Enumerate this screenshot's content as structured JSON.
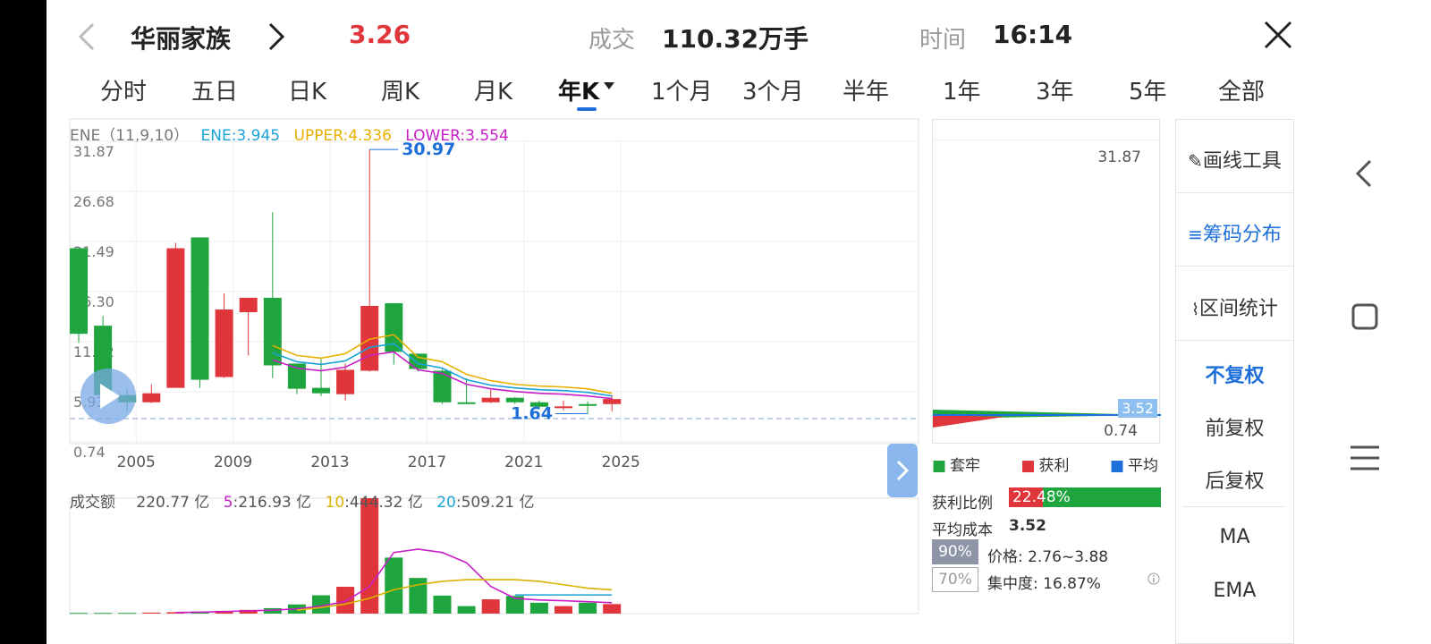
{
  "header": {
    "back_icon": "chevron-left-icon",
    "stock_name": "华丽家族",
    "next_icon": "chevron-right-icon",
    "price": "3.26",
    "volume_label": "成交",
    "volume_value": "110.32万手",
    "time_label": "时间",
    "time_value": "16:14",
    "close_icon": "close-icon"
  },
  "tabs": [
    "分时",
    "五日",
    "日K",
    "周K",
    "月K",
    "年K",
    "1个月",
    "3个月",
    "半年",
    "1年",
    "3年",
    "5年",
    "全部"
  ],
  "active_tab": "年K",
  "indicator": {
    "name": "ENE（11,9,10）",
    "ene": "ENE:3.945",
    "upper": "UPPER:4.336",
    "lower": "LOWER:3.554"
  },
  "price_axis": [
    "31.87",
    "26.68",
    "21.49",
    "16.30",
    "11.12",
    "5.93",
    "0.74"
  ],
  "x_axis": [
    "2005",
    "2009",
    "2013",
    "2017",
    "2021",
    "2025"
  ],
  "annotations": {
    "high": "30.97",
    "low": "1.64"
  },
  "volume_legend": {
    "label": "成交额",
    "total": "220.77 亿",
    "ma5_key": "5",
    "ma5_val": ":216.93 亿",
    "ma10_key": "10",
    "ma10_val": ":444.32 亿",
    "ma20_key": "20",
    "ma20_val": ":509.21 亿"
  },
  "chip_panel": {
    "top_value": "31.87",
    "current_value": "3.52",
    "bottom_value": "0.74",
    "legend": [
      "套牢",
      "获利",
      "平均"
    ],
    "profit_ratio_label": "获利比例",
    "profit_ratio_value": "22.48%",
    "profit_ratio": 0.2248,
    "avg_cost_label": "平均成本",
    "avg_cost_value": "3.52",
    "badge_90": "90%",
    "range_90": "价格: 2.76~3.88",
    "badge_70": "70%",
    "concentration": "集中度: 16.87%",
    "info_icon": "info-icon"
  },
  "side_menu": {
    "draw_tool": "画线工具",
    "chip_dist": "筹码分布",
    "range_stats": "区间统计",
    "no_adjust": "不复权",
    "forward_adjust": "前复权",
    "backward_adjust": "后复权",
    "ma": "MA",
    "ema": "EMA"
  },
  "nav": {
    "back": "nav-back-icon",
    "home": "nav-home-icon",
    "menu": "nav-menu-icon"
  },
  "colors": {
    "up": "#e0363b",
    "down": "#1fa53d",
    "ene": "#1aa3d8",
    "upper": "#e8b000",
    "lower": "#c71ec7",
    "accent": "#1e6fd9",
    "ma5": "#c71ec7",
    "ma10": "#d8b400",
    "ma20": "#1aa3d8"
  },
  "chart_data": {
    "type": "candlestick",
    "years": [
      2003,
      2004,
      2005,
      2006,
      2007,
      2008,
      2009,
      2010,
      2011,
      2012,
      2013,
      2014,
      2015,
      2016,
      2017,
      2018,
      2019,
      2020,
      2021,
      2022,
      2023,
      2024,
      2025
    ],
    "candles": [
      {
        "o": 20.0,
        "c": 10.5,
        "h": 20.0,
        "l": 9.5
      },
      {
        "o": 11.4,
        "c": 3.7,
        "h": 12.5,
        "l": 3.2
      },
      {
        "o": 3.7,
        "c": 2.9,
        "h": 4.3,
        "l": 1.9
      },
      {
        "o": 2.9,
        "c": 3.9,
        "h": 4.9,
        "l": 2.8
      },
      {
        "o": 4.5,
        "c": 20.0,
        "h": 20.6,
        "l": 4.5
      },
      {
        "o": 21.2,
        "c": 5.4,
        "h": 21.2,
        "l": 4.5
      },
      {
        "o": 5.7,
        "c": 13.2,
        "h": 15.0,
        "l": 5.6
      },
      {
        "o": 12.9,
        "c": 14.5,
        "h": 14.5,
        "l": 8.1
      },
      {
        "o": 14.5,
        "c": 7.0,
        "h": 24.0,
        "l": 5.6
      },
      {
        "o": 7.2,
        "c": 4.4,
        "h": 7.2,
        "l": 3.8
      },
      {
        "o": 4.5,
        "c": 3.9,
        "h": 7.7,
        "l": 3.6
      },
      {
        "o": 3.8,
        "c": 6.5,
        "h": 7.2,
        "l": 3.1
      },
      {
        "o": 6.4,
        "c": 13.6,
        "h": 30.97,
        "l": 6.3
      },
      {
        "o": 13.9,
        "c": 8.5,
        "h": 13.9,
        "l": 7.1
      },
      {
        "o": 8.3,
        "c": 6.6,
        "h": 8.3,
        "l": 6.3
      },
      {
        "o": 6.4,
        "c": 2.9,
        "h": 6.6,
        "l": 2.7
      },
      {
        "o": 2.9,
        "c": 2.8,
        "h": 5.6,
        "l": 2.7
      },
      {
        "o": 2.9,
        "c": 3.4,
        "h": 4.3,
        "l": 2.8
      },
      {
        "o": 3.4,
        "c": 2.9,
        "h": 3.5,
        "l": 2.7
      },
      {
        "o": 2.9,
        "c": 2.4,
        "h": 3.1,
        "l": 2.1
      },
      {
        "o": 2.45,
        "c": 2.45,
        "h": 3.1,
        "l": 2.0
      },
      {
        "o": 2.7,
        "c": 2.6,
        "h": 3.0,
        "l": 1.64
      },
      {
        "o": 2.7,
        "c": 3.26,
        "h": 3.7,
        "l": 1.9
      }
    ],
    "ene_series": {
      "upper": [
        null,
        null,
        null,
        null,
        null,
        null,
        null,
        null,
        9.2,
        8.1,
        7.8,
        8.3,
        9.9,
        10.4,
        7.9,
        7.4,
        6.0,
        5.3,
        4.9,
        4.7,
        4.6,
        4.4,
        3.9
      ],
      "ene": [
        null,
        null,
        null,
        null,
        null,
        null,
        null,
        null,
        8.4,
        7.4,
        7.1,
        7.5,
        9.0,
        9.4,
        7.2,
        6.7,
        5.4,
        4.8,
        4.5,
        4.3,
        4.2,
        4.0,
        3.6
      ],
      "lower": [
        null,
        null,
        null,
        null,
        null,
        null,
        null,
        null,
        7.6,
        6.7,
        6.4,
        6.8,
        8.1,
        8.5,
        6.5,
        6.1,
        4.9,
        4.4,
        4.1,
        3.9,
        3.8,
        3.6,
        3.3
      ]
    },
    "volume": {
      "values": [
        2,
        2,
        2,
        3,
        4,
        6,
        8,
        11,
        16,
        27,
        54,
        79,
        340,
        165,
        105,
        53,
        22,
        42,
        52,
        32,
        22,
        32,
        28
      ],
      "max": 340,
      "ma5": [
        null,
        null,
        null,
        null,
        3,
        4,
        6,
        8,
        10,
        14,
        22,
        36,
        80,
        180,
        190,
        180,
        150,
        80,
        45,
        40,
        38,
        35,
        32
      ],
      "ma10": [
        null,
        null,
        null,
        null,
        null,
        null,
        null,
        null,
        null,
        10,
        18,
        28,
        45,
        70,
        85,
        95,
        100,
        100,
        100,
        95,
        85,
        75,
        70
      ],
      "ma20": [
        null,
        null,
        null,
        null,
        null,
        null,
        null,
        null,
        null,
        null,
        null,
        null,
        null,
        null,
        null,
        null,
        null,
        null,
        55,
        55,
        55,
        55,
        55
      ]
    }
  }
}
